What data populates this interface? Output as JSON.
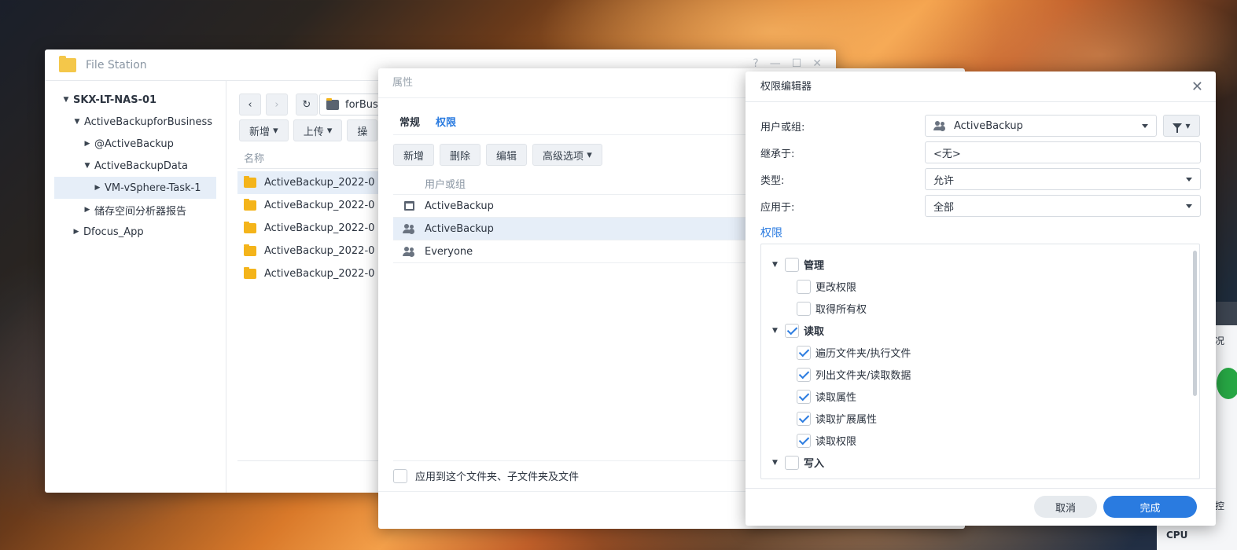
{
  "file_station": {
    "title": "File Station",
    "controls": [
      "?",
      "—",
      "☐",
      "✕"
    ],
    "tree": [
      {
        "label": "SKX-LT-NAS-01",
        "level": 0,
        "expanded": true,
        "bold": true
      },
      {
        "label": "ActiveBackupforBusiness",
        "level": 1,
        "expanded": true
      },
      {
        "label": "@ActiveBackup",
        "level": 2,
        "expanded": false
      },
      {
        "label": "ActiveBackupData",
        "level": 2,
        "expanded": true
      },
      {
        "label": "VM-vSphere-Task-1",
        "level": 3,
        "expanded": false,
        "selected": true
      },
      {
        "label": "储存空间分析器报告",
        "level": 2,
        "expanded": false
      },
      {
        "label": "Dfocus_App",
        "level": 1,
        "expanded": false
      }
    ],
    "path": "forBus",
    "toolbar": {
      "new": "新增",
      "upload": "上传",
      "action": "操"
    },
    "column_name": "名称",
    "files": [
      "ActiveBackup_2022-0",
      "ActiveBackup_2022-0",
      "ActiveBackup_2022-0",
      "ActiveBackup_2022-0",
      "ActiveBackup_2022-0"
    ]
  },
  "properties": {
    "title": "属性",
    "tabs": [
      {
        "label": "常规",
        "active": false
      },
      {
        "label": "权限",
        "active": true
      }
    ],
    "toolbar": {
      "new": "新增",
      "delete": "删除",
      "edit": "编辑",
      "advanced": "高级选项"
    },
    "column_user": "用户或组",
    "rows": [
      {
        "icon": "calendar-icon",
        "name": "ActiveBackup",
        "selected": false
      },
      {
        "icon": "user-group-icon",
        "name": "ActiveBackup",
        "selected": true
      },
      {
        "icon": "user-group-icon",
        "name": "Everyone",
        "selected": false
      }
    ],
    "apply_label": "应用到这个文件夹、子文件夹及文件"
  },
  "permission_editor": {
    "title": "权限编辑器",
    "user_label": "用户或组:",
    "user_value": "ActiveBackup",
    "inherit_label": "继承于:",
    "inherit_value": "<无>",
    "type_label": "类型:",
    "type_value": "允许",
    "apply_label": "应用于:",
    "apply_value": "全部",
    "section": "权限",
    "perms": [
      {
        "label": "管理",
        "group": true,
        "checked": false
      },
      {
        "label": "更改权限",
        "group": false,
        "checked": false
      },
      {
        "label": "取得所有权",
        "group": false,
        "checked": false
      },
      {
        "label": "读取",
        "group": true,
        "checked": true
      },
      {
        "label": "遍历文件夹/执行文件",
        "group": false,
        "checked": true
      },
      {
        "label": "列出文件夹/读取数据",
        "group": false,
        "checked": true
      },
      {
        "label": "读取属性",
        "group": false,
        "checked": true
      },
      {
        "label": "读取扩展属性",
        "group": false,
        "checked": true
      },
      {
        "label": "读取权限",
        "group": false,
        "checked": true
      },
      {
        "label": "写入",
        "group": true,
        "checked": false
      }
    ],
    "cancel": "取消",
    "done": "完成"
  },
  "side_widget": {
    "text1": "况",
    "text2": "控",
    "cpu": "CPU"
  }
}
